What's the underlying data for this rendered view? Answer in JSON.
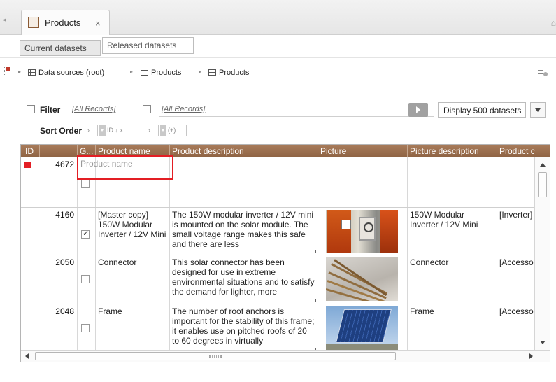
{
  "tabs": {
    "main_tab_label": "Products",
    "close_glyph": "×",
    "sub_tabs": [
      "Current datasets",
      "Released datasets"
    ]
  },
  "breadcrumb": {
    "items": [
      "Data sources (root)",
      "Products",
      "Products"
    ]
  },
  "filter": {
    "label": "Filter",
    "all_records_1": "[All Records]",
    "all_records_2": "[All Records]",
    "display_select": "Display 500 datasets"
  },
  "sort": {
    "label": "Sort Order",
    "chip1": "ID  ↓ x",
    "chip2": "(+)"
  },
  "grid": {
    "columns": [
      "ID",
      "G...",
      "Product name",
      "Product description",
      "Picture",
      "Picture description",
      "Product c"
    ],
    "new_row": {
      "id": "4672",
      "name_placeholder": "Product name"
    },
    "rows": [
      {
        "id": "4160",
        "checked": true,
        "name": "[Master copy] 150W Modular Inverter / 12V Mini",
        "description": "The 150W modular inverter / 12V mini is mounted on the solar module. The small voltage range makes this safe and there are less",
        "picture": "inverter-image",
        "picture_description": "150W Modular Inverter / 12V Mini",
        "category": "[Inverter]"
      },
      {
        "id": "2050",
        "checked": false,
        "name": "Connector",
        "description": "This solar connector has been designed for use in extreme environmental situations and to satisfy the demand for lighter, more",
        "picture": "connector-image",
        "picture_description": "Connector",
        "category": "[Accesso"
      },
      {
        "id": "2048",
        "checked": false,
        "name": "Frame",
        "description": "The number of roof anchors is important for the stability of this frame; it enables use on pitched roofs of 20 to 60 degrees in virtually",
        "picture": "solar-frame-image",
        "picture_description": "Frame",
        "category": "[Accesso"
      }
    ]
  },
  "colors": {
    "header_brown": "#9a6e4e",
    "highlight_red": "#e31e24"
  }
}
